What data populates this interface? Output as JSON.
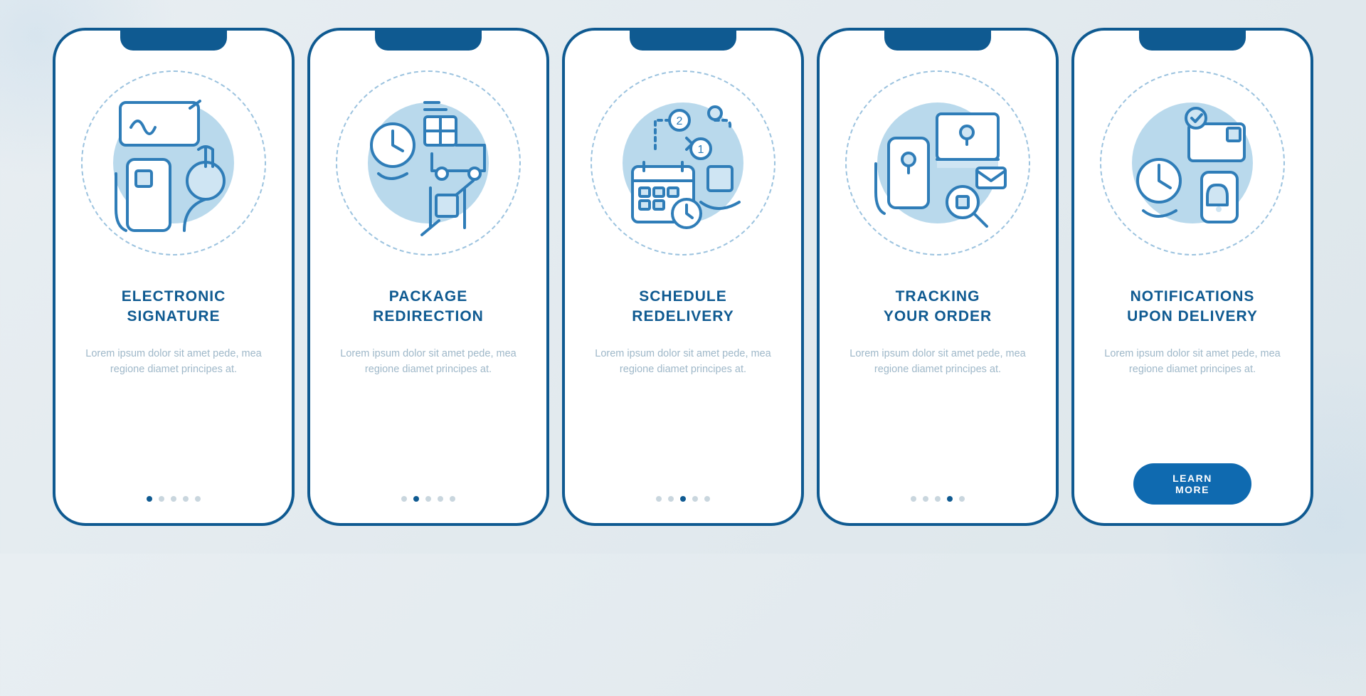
{
  "colors": {
    "primary": "#0f5a91",
    "accent": "#0f6ab0",
    "illus_bg": "#b9d9ec",
    "body_text": "#9fb8c9"
  },
  "screens": [
    {
      "icon": "electronic-signature-icon",
      "title": "ELECTRONIC\nSIGNATURE",
      "body": "Lorem ipsum dolor sit amet pede, mea regione diamet principes at.",
      "active_dot": 0,
      "show_cta": false
    },
    {
      "icon": "package-redirection-icon",
      "title": "PACKAGE\nREDIRECTION",
      "body": "Lorem ipsum dolor sit amet pede, mea regione diamet principes at.",
      "active_dot": 1,
      "show_cta": false
    },
    {
      "icon": "schedule-redelivery-icon",
      "title": "SCHEDULE\nREDELIVERY",
      "body": "Lorem ipsum dolor sit amet pede, mea regione diamet principes at.",
      "active_dot": 2,
      "show_cta": false
    },
    {
      "icon": "tracking-order-icon",
      "title": "TRACKING\nYOUR ORDER",
      "body": "Lorem ipsum dolor sit amet pede, mea regione diamet principes at.",
      "active_dot": 3,
      "show_cta": false
    },
    {
      "icon": "notifications-delivery-icon",
      "title": "NOTIFICATIONS\nUPON DELIVERY",
      "body": "Lorem ipsum dolor sit amet pede, mea regione diamet principes at.",
      "active_dot": 4,
      "show_cta": true
    }
  ],
  "cta_label": "LEARN MORE",
  "dot_count": 5
}
